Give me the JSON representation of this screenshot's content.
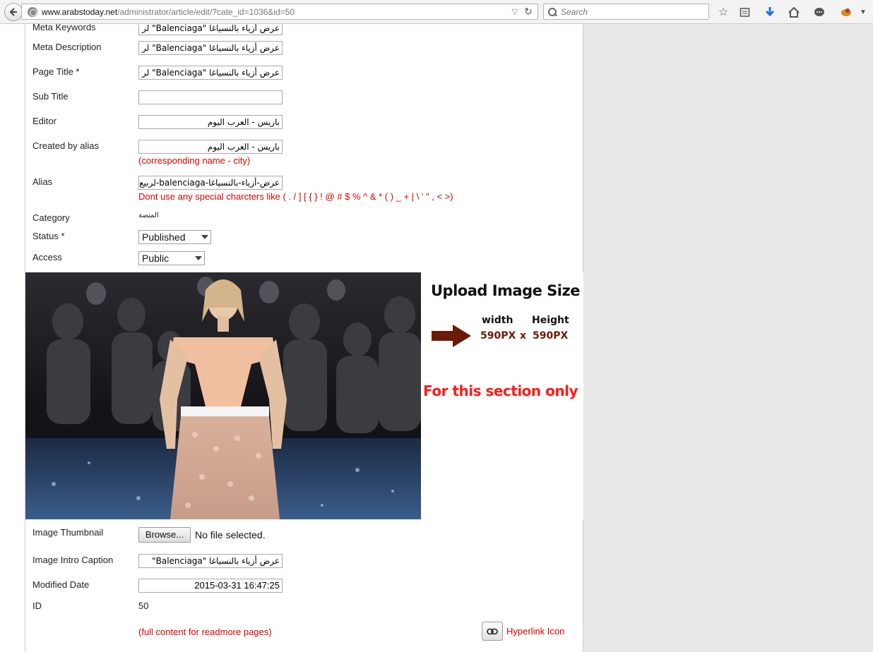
{
  "browser": {
    "url_domain": "www.arabstoday.net",
    "url_path": "/administrator/article/edit/?cate_id=1036&id=50",
    "search_placeholder": "Search"
  },
  "form": {
    "meta_keywords": {
      "label": "Meta Keywords",
      "value": "عرض أزياء بالنسياغا \"Balenciaga\" لر"
    },
    "meta_description": {
      "label": "Meta Description",
      "value": "عرض أزياء بالنسياغا \"Balenciaga\" لر"
    },
    "page_title": {
      "label": "Page Title *",
      "value": "عرض أزياء بالنسياغا \"Balenciaga\" لر"
    },
    "sub_title": {
      "label": "Sub Title",
      "value": ""
    },
    "editor": {
      "label": "Editor",
      "value": "باريس - العرب اليوم"
    },
    "created_by_alias": {
      "label": "Created by alias",
      "value": "باريس - العرب اليوم",
      "hint": "(corresponding name - city)"
    },
    "alias": {
      "label": "Alias",
      "value": "عرض-أزياء-بالنسياغا-balenciaga-لربيع",
      "hint": "Dont use any special charcters like ( . / ] [ { } ! @ # $ % ^ & * ( ) _ + | \\ ' \" , < >)"
    },
    "category": {
      "label": "Category",
      "value": "المنصة"
    },
    "status": {
      "label": "Status *",
      "value": "Published"
    },
    "access": {
      "label": "Access",
      "value": "Public"
    },
    "image_thumbnail": {
      "label": "Image Thumbnail",
      "button": "Browse...",
      "file_status": "No file selected."
    },
    "image_intro_caption": {
      "label": "Image Intro Caption",
      "value": "عرض أزياء بالنسياغا \"Balenciaga\""
    },
    "modified_date": {
      "label": "Modified Date",
      "value": "2015-03-31 16:47:25"
    },
    "id": {
      "label": "ID",
      "value": "50"
    },
    "fulltext_hint": "(full content for readmore pages)",
    "hyperlink_label": "Hyperlink Icon"
  },
  "banner": {
    "title": "Upload Image Size",
    "width_label": "width",
    "height_label": "Height",
    "width_value": "590PX",
    "times": "x",
    "height_value": "590PX",
    "note": "For this section only"
  },
  "colors": {
    "hint_red": "#e00000",
    "banner_red": "#ff1a1a",
    "banner_brown": "#6b1a08"
  }
}
